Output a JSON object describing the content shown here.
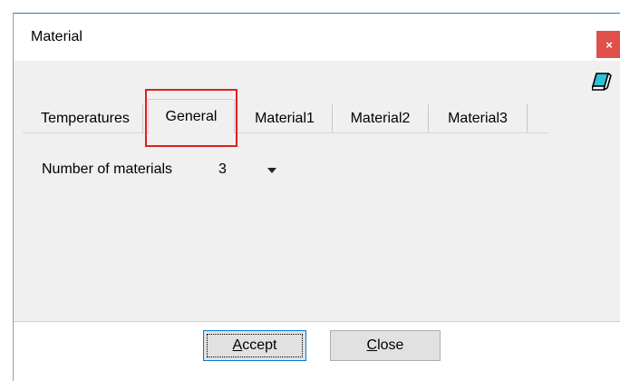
{
  "window": {
    "title": "Material",
    "close_label": "×"
  },
  "tabs": [
    {
      "label": "Temperatures",
      "active": false
    },
    {
      "label": "General",
      "active": true
    },
    {
      "label": "Material1",
      "active": false
    },
    {
      "label": "Material2",
      "active": false
    },
    {
      "label": "Material3",
      "active": false
    }
  ],
  "general": {
    "num_materials_label": "Number of materials",
    "num_materials_value": "3"
  },
  "buttons": {
    "accept_first": "A",
    "accept_rest": "ccept",
    "close_first": "C",
    "close_rest": "lose"
  },
  "icons": {
    "close": "close-icon",
    "eraser": "eraser-icon",
    "dropdown": "chevron-down-icon"
  },
  "colors": {
    "close_bg": "#e0504a",
    "highlight": "#e0201a",
    "accept_border": "#0078d7"
  }
}
